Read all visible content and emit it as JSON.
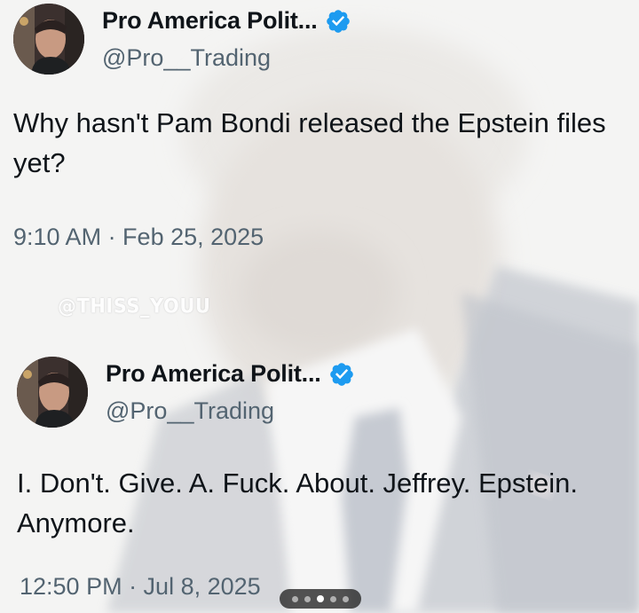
{
  "watermark": "@THISS_YOUU",
  "colors": {
    "verified_badge": "#1d9bf0",
    "text_primary": "#0f1419",
    "text_secondary": "#536471"
  },
  "tweets": [
    {
      "display_name": "Pro America Polit...",
      "handle": "@Pro__Trading",
      "verified_icon": "verified-badge-icon",
      "text": "Why hasn't Pam Bondi released the Epstein files yet?",
      "timestamp": "9:10 AM · Feb 25, 2025"
    },
    {
      "display_name": "Pro America Polit...",
      "handle": "@Pro__Trading",
      "verified_icon": "verified-badge-icon",
      "text": "I. Don't. Give. A. Fuck. About. Jeffrey. Epstein. Anymore.",
      "timestamp": "12:50 PM · Jul 8, 2025"
    }
  ],
  "carousel": {
    "total": 5,
    "active_index": 2
  }
}
